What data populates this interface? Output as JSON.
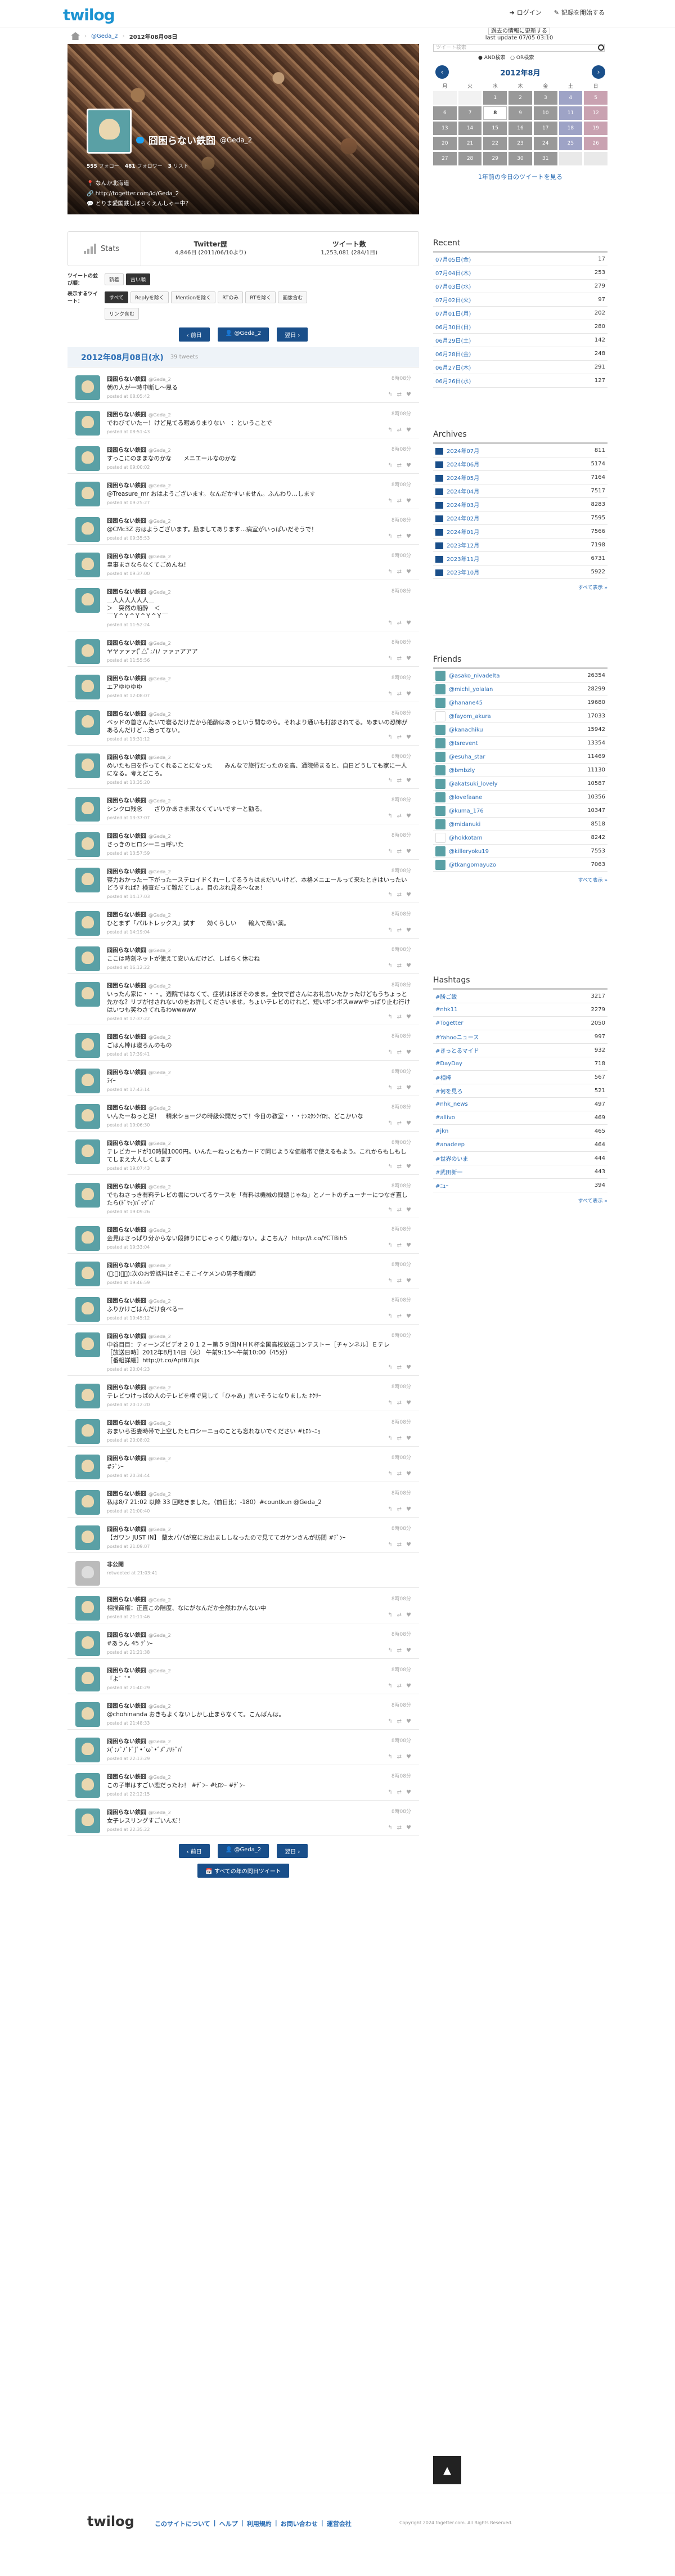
{
  "header": {
    "logo": "twilog",
    "login": "ログイン",
    "register": "記録を開始する"
  },
  "breadcrumb": {
    "user": "@Geda_2",
    "date": "2012年08月08日"
  },
  "profile": {
    "name": "囧困らない鉄囧",
    "handle": "@Geda_2",
    "tweets_count": "555",
    "tweets_label": "フォロー",
    "followers_count": "481",
    "followers_label": "フォロワー",
    "lists_count": "3",
    "lists_label": "リスト",
    "location": "なんか北海道",
    "url": "http://togetter.com/id/Geda_2",
    "bio": "とりま愛国鉄しばらくえんしゃー中？"
  },
  "stats": {
    "label": "Stats",
    "col1_title": "Twitter歴",
    "col1_value": "4,846日 (2011/06/10より)",
    "col2_title": "ツイート数",
    "col2_value": "1,253,081 (284/1日)"
  },
  "filters": {
    "order_label": "ツイートの並び順：",
    "order_new": "新着",
    "order_old": "古い順",
    "show_label": "表示するツイート：",
    "opts": [
      "すべて",
      "Replyを除く",
      "Mentionを除く",
      "RTのみ",
      "RTを除く",
      "画像含む",
      "リンク含む"
    ]
  },
  "pager": {
    "prev": "前日",
    "user": "@Geda_2",
    "next": "翌日"
  },
  "dateheader": {
    "date": "2012年08月08日(水)",
    "count": "39 tweets"
  },
  "tweets": [
    {
      "name": "囧困らない鉄囧",
      "handle": "@Geda_2",
      "time": "8時08分",
      "text": "朝の人が一時中断し～思る",
      "posted": "posted at 08:05:42"
    },
    {
      "name": "囧困らない鉄囧",
      "handle": "@Geda_2",
      "time": "8時08分",
      "text": "でわびていたー！けど見てる暇ありまりない　：ということで",
      "posted": "posted at 08:51:43"
    },
    {
      "name": "囧困らない鉄囧",
      "handle": "@Geda_2",
      "time": "8時08分",
      "text": "すっこにのままなのかな　　メニエールなのかな",
      "posted": "posted at 09:00:02"
    },
    {
      "name": "囧困らない鉄囧",
      "handle": "@Geda_2",
      "time": "8時08分",
      "text": "@Treasure_mr おはようございます。なんだかすいません。ふんわり…します",
      "posted": "posted at 09:25:27"
    },
    {
      "name": "囧困らない鉄囧",
      "handle": "@Geda_2",
      "time": "8時08分",
      "text": "@CMc3Z おはようございます。励ましてあります…病室がいっぱいだそうで！",
      "posted": "posted at 09:35:53"
    },
    {
      "name": "囧困らない鉄囧",
      "handle": "@Geda_2",
      "time": "8時08分",
      "text": "皇事まさならなくてごめんね！",
      "posted": "posted at 09:37:00"
    },
    {
      "name": "囧困らない鉄囧",
      "handle": "@Geda_2",
      "time": "8時08分",
      "text": "＿人人人人人人＿\n＞　突然の船酔　＜\n￣Ｙ^Ｙ^Ｙ^Ｙ^Ｙ￣",
      "posted": "posted at 11:52:24"
    },
    {
      "name": "囧困らない鉄囧",
      "handle": "@Geda_2",
      "time": "8時08分",
      "text": "ヤヤァァァ(ﾟ△ﾟ;ﾉ)ﾉ ァァァアアア",
      "posted": "posted at 11:55:56"
    },
    {
      "name": "囧困らない鉄囧",
      "handle": "@Geda_2",
      "time": "8時08分",
      "text": "エアゆゆゆゆ",
      "posted": "posted at 12:08:07"
    },
    {
      "name": "囧困らない鉄囧",
      "handle": "@Geda_2",
      "time": "8時08分",
      "text": "ベッドの首さんたいで寝るだけだから船酔はあっという間なのら。それより通いも打診されてる。めまいの恐怖があるんだけど…治ってない。",
      "posted": "posted at 13:31:12"
    },
    {
      "name": "囧困らない鉄囧",
      "handle": "@Geda_2",
      "time": "8時08分",
      "text": "めいたも日を作ってくれることになった　　みんなで旅行だったのを高、通院帰まると、自日どうしても家に一人になる。考えどころ。",
      "posted": "posted at 13:35:20"
    },
    {
      "name": "囧困らない鉄囧",
      "handle": "@Geda_2",
      "time": "8時08分",
      "text": "シンクロ残念　　ざりかあさま来なくていいですーと勧る。",
      "posted": "posted at 13:37:07"
    },
    {
      "name": "囧困らない鉄囧",
      "handle": "@Geda_2",
      "time": "8時08分",
      "text": "さっきのヒロシーニョ呼いた",
      "posted": "posted at 13:57:59"
    },
    {
      "name": "囧困らない鉄囧",
      "handle": "@Geda_2",
      "time": "8時08分",
      "text": "寝力おかったー下がったーステロイドくれーしてるうちはまだいいけど、本格メニエールって来たときはいったいどうすれば？検査だって難だてしょ。目のぶれ見る～なぁ！",
      "posted": "posted at 14:17:03"
    },
    {
      "name": "囧困らない鉄囧",
      "handle": "@Geda_2",
      "time": "8時08分",
      "text": "ひとまず「パルトレックス」試す　　効くらしい　　輸入で高い薬。",
      "posted": "posted at 14:19:04"
    },
    {
      "name": "囧困らない鉄囧",
      "handle": "@Geda_2",
      "time": "8時08分",
      "text": "ここは時刻ネットが使えて安いんだけど、しばらく休むね",
      "posted": "posted at 16:12:22"
    },
    {
      "name": "囧困らない鉄囧",
      "handle": "@Geda_2",
      "time": "8時08分",
      "text": "いったん家に・・・。週院ではなくて、症状はほぼそのまま。全快で首さんにお礼言いたかったけどもうちょっと先かな？リプが付されないのをお許しくださいませ。ちょいテレビのけれど、短いポンボスwwwやっぱり止む行けはいつも笑わさてれるわwwwww",
      "posted": "posted at 17:37:22"
    },
    {
      "name": "囧困らない鉄囧",
      "handle": "@Geda_2",
      "time": "8時08分",
      "text": "ごはん棒は寝ろんのもの",
      "posted": "posted at 17:39:41"
    },
    {
      "name": "囧困らない鉄囧",
      "handle": "@Geda_2",
      "time": "8時08分",
      "text": "ﾃｲｰ",
      "posted": "posted at 17:43:14"
    },
    {
      "name": "囧困らない鉄囧",
      "handle": "@Geda_2",
      "time": "8時08分",
      "text": "いんたーねっと足！　精米ショージの時級公開だって！今日の教室・・・ﾅﾝｽﾀｼｸｲﾛｾ、どこかいな",
      "posted": "posted at 19:06:30"
    },
    {
      "name": "囧困らない鉄囧",
      "handle": "@Geda_2",
      "time": "8時08分",
      "text": "テレビカードが10時間1000円。いんたーねっともカードで同じような価格帯で使えるもよう。これからもしもしてしまえ大人しくします",
      "posted": "posted at 19:07:43"
    },
    {
      "name": "囧困らない鉄囧",
      "handle": "@Geda_2",
      "time": "8時08分",
      "text": "でもねさっき有料テレビの書についてるケースを「有料は機械の間題じゃね」とノートのチューナーにつなぎ直したら(ﾄﾞﾔｯ)ﾊﾞｯｸﾞﾊﾞ",
      "posted": "posted at 19:09:26"
    },
    {
      "name": "囧困らない鉄囧",
      "handle": "@Geda_2",
      "time": "8時08分",
      "text": "金見はさっぱり分からない段飾りにじゃっくり離けない。よこちん？ http://t.co/YCTBih5",
      "posted": "posted at 19:33:04"
    },
    {
      "name": "囧困らない鉄囧",
      "handle": "@Geda_2",
      "time": "8時08分",
      "text": "(ﾟ;ﾟ)：ﾞ):次のお笠話料はそこそこイケメンの男子看護師",
      "posted": "posted at 19:46:59"
    },
    {
      "name": "囧困らない鉄囧",
      "handle": "@Geda_2",
      "time": "8時08分",
      "text": "ふりかけごはんだけ食べるー",
      "posted": "posted at 19:45:12"
    },
    {
      "name": "囧困らない鉄囧",
      "handle": "@Geda_2",
      "time": "8時08分",
      "text": "中谷目目：ティーンズビデオ２０１２－第５９回ＮＨＫ杯全国高校放送コンテスト－［チャンネル］Ｅテレ\n［放送日時］2012年8月14日（火） 午前9:15～午前10:00（45分）\n［番組詳細］http://t.co/ApfB7Ljx",
      "posted": "posted at 20:04:23"
    },
    {
      "name": "囧困らない鉄囧",
      "handle": "@Geda_2",
      "time": "8時08分",
      "text": "テレビつけっぱの人のテレビを横で見して「ひゃあ」言いそうになりました ﾎｹﾘｰ",
      "posted": "posted at 20:12:20"
    },
    {
      "name": "囧困らない鉄囧",
      "handle": "@Geda_2",
      "time": "8時08分",
      "text": "おまいら否妻時帯で上空したヒロシーニョのことも忘れないでください #ﾋﾛｼｰﾆｮ",
      "posted": "posted at 20:08:02"
    },
    {
      "name": "囧困らない鉄囧",
      "handle": "@Geda_2",
      "time": "8時08分",
      "text": "#ﾃﾞﾝｰ",
      "posted": "posted at 20:34:44"
    },
    {
      "name": "囧困らない鉄囧",
      "handle": "@Geda_2",
      "time": "8時08分",
      "text": "私は8/7 21:02 以降 33 回吃きました。（前日比：-180）#countkun @Geda_2",
      "posted": "posted at 21:00:40"
    },
    {
      "name": "囧困らない鉄囧",
      "handle": "@Geda_2",
      "time": "8時08分",
      "text": "【ガワン JUST IN】 蘭太パパが窓にお出まししなったので見ててガケンさんが訪問 #ﾃﾞﾝｰ",
      "posted": "posted at 21:09:07"
    },
    {
      "name": "非公開",
      "handle": "",
      "time": "",
      "text": "",
      "posted": "retweeted at 21:03:41"
    },
    {
      "name": "囧困らない鉄囧",
      "handle": "@Geda_2",
      "time": "8時08分",
      "text": "相撲商権：正直この階度、なにがなんだか全然わかんない中",
      "posted": "posted at 21:11:46"
    },
    {
      "name": "囧困らない鉄囧",
      "handle": "@Geda_2",
      "time": "8時08分",
      "text": "#あうん 45 ﾃﾞﾝｰ",
      "posted": "posted at 21:21:38"
    },
    {
      "name": "囧困らない鉄囧",
      "handle": "@Geda_2",
      "time": "8時08分",
      "text": "「よ゛ﾟ\"",
      "posted": "posted at 21:40:29"
    },
    {
      "name": "囧困らない鉄囧",
      "handle": "@Geda_2",
      "time": "8時08分",
      "text": "@chohinanda おきもよくないしかし止まらなくて。こんばんは。",
      "posted": "posted at 21:48:33"
    },
    {
      "name": "囧困らない鉄囧",
      "handle": "@Geda_2",
      "time": "8時08分",
      "text": "ﾒ(ﾟ;ﾉﾞﾉﾞﾄﾞ)ﾟ•´ω`•ﾞﾒﾞﾉﾘﾄﾞﾊﾟ",
      "posted": "posted at 22:13:29"
    },
    {
      "name": "囧困らない鉄囧",
      "handle": "@Geda_2",
      "time": "8時08分",
      "text": "この子単はすごい恋だったわ！ #ﾃﾞﾝｰ #ﾋﾛｼｰ #ﾃﾞﾝｰ",
      "posted": "posted at 22:12:15"
    },
    {
      "name": "囧困らない鉄囧",
      "handle": "@Geda_2",
      "time": "8時08分",
      "text": "女子レスリングすごいんだ！",
      "posted": "posted at 22:35:22"
    }
  ],
  "bottom_link": "すべての年の同日ツイート",
  "sidebar": {
    "notice": "過去の情報に更新する",
    "last_update": "last update 07/05 03:10",
    "search_placeholder": "ツイート検索",
    "radio_and": "AND検索",
    "radio_or": "OR検索",
    "cal_title": "2012年8月",
    "cal_prev": "‹",
    "cal_next": "›",
    "weekdays": [
      "月",
      "火",
      "水",
      "木",
      "金",
      "土",
      "日"
    ],
    "cal_link": "1年前の今日のツイートを見る",
    "recent_title": "Recent",
    "recent": [
      {
        "d": "07月05日(金)",
        "c": "17"
      },
      {
        "d": "07月04日(木)",
        "c": "253"
      },
      {
        "d": "07月03日(水)",
        "c": "279"
      },
      {
        "d": "07月02日(火)",
        "c": "97"
      },
      {
        "d": "07月01日(月)",
        "c": "202"
      },
      {
        "d": "06月30日(日)",
        "c": "280"
      },
      {
        "d": "06月29日(土)",
        "c": "142"
      },
      {
        "d": "06月28日(金)",
        "c": "248"
      },
      {
        "d": "06月27日(木)",
        "c": "291"
      },
      {
        "d": "06月26日(水)",
        "c": "127"
      }
    ],
    "archives_title": "Archives",
    "archives": [
      {
        "d": "2024年07月",
        "c": "811"
      },
      {
        "d": "2024年06月",
        "c": "5174"
      },
      {
        "d": "2024年05月",
        "c": "7164"
      },
      {
        "d": "2024年04月",
        "c": "7517"
      },
      {
        "d": "2024年03月",
        "c": "8283"
      },
      {
        "d": "2024年02月",
        "c": "7595"
      },
      {
        "d": "2024年01月",
        "c": "7566"
      },
      {
        "d": "2023年12月",
        "c": "7198"
      },
      {
        "d": "2023年11月",
        "c": "6731"
      },
      {
        "d": "2023年10月",
        "c": "5922"
      }
    ],
    "more": "すべて表示 »",
    "friends_title": "Friends",
    "friends": [
      {
        "d": "@asako_nivadelta",
        "c": "26354"
      },
      {
        "d": "@michi_yolalan",
        "c": "28299"
      },
      {
        "d": "@hanane45",
        "c": "19680"
      },
      {
        "d": "@fayom_akura",
        "c": "17033"
      },
      {
        "d": "@kanachiku",
        "c": "15942"
      },
      {
        "d": "@tsrevent",
        "c": "13354"
      },
      {
        "d": "@esuha_star",
        "c": "11469"
      },
      {
        "d": "@bmbzly",
        "c": "11130"
      },
      {
        "d": "@akatsuki_lovely",
        "c": "10587"
      },
      {
        "d": "@lovefaane",
        "c": "10356"
      },
      {
        "d": "@kuma_176",
        "c": "10347"
      },
      {
        "d": "@midanuki",
        "c": "8518"
      },
      {
        "d": "@hokkotam",
        "c": "8242"
      },
      {
        "d": "@killeryoku19",
        "c": "7553"
      },
      {
        "d": "@tkangomayuzo",
        "c": "7063"
      }
    ],
    "hashtags_title": "Hashtags",
    "hashtags": [
      {
        "d": "#勝ご飯",
        "c": "3217"
      },
      {
        "d": "#nhk11",
        "c": "2279"
      },
      {
        "d": "#Togetter",
        "c": "2050"
      },
      {
        "d": "#Yahooニュース",
        "c": "997"
      },
      {
        "d": "#きっとるマイド",
        "c": "932"
      },
      {
        "d": "#DayDay",
        "c": "718"
      },
      {
        "d": "#相棒",
        "c": "567"
      },
      {
        "d": "#何を見ろ",
        "c": "521"
      },
      {
        "d": "#nhk_news",
        "c": "497"
      },
      {
        "d": "#allivo",
        "c": "469"
      },
      {
        "d": "#jkn",
        "c": "465"
      },
      {
        "d": "#anadeep",
        "c": "464"
      },
      {
        "d": "#世界のいま",
        "c": "444"
      },
      {
        "d": "#武田新一",
        "c": "443"
      },
      {
        "d": "#ﾆｭｰ",
        "c": "394"
      }
    ]
  },
  "footer": {
    "logo": "twilog",
    "links": [
      "このサイトについて",
      "ヘルプ",
      "利用規約",
      "お問い合わせ",
      "運営会社"
    ],
    "copyright": "Copyright 2024 togetter.com. All Rights Reserved."
  }
}
